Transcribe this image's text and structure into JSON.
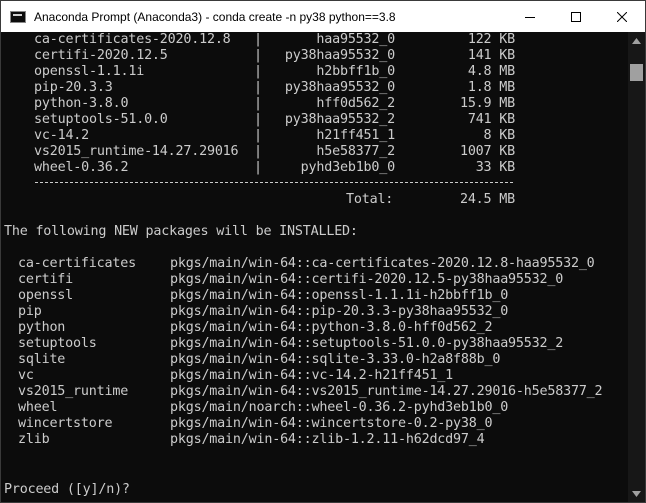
{
  "window": {
    "title": "Anaconda Prompt (Anaconda3) - conda  create -n py38 python==3.8",
    "controls": {
      "minimize": "minimize-icon",
      "maximize": "maximize-icon",
      "close": "close-icon"
    }
  },
  "download_table": [
    {
      "name": "ca-certificates-2020.12.8",
      "build": "haa95532_0",
      "size": "122 KB"
    },
    {
      "name": "certifi-2020.12.5",
      "build": "py38haa95532_0",
      "size": "141 KB"
    },
    {
      "name": "openssl-1.1.1i",
      "build": "h2bbff1b_0",
      "size": "4.8 MB"
    },
    {
      "name": "pip-20.3.3",
      "build": "py38haa95532_0",
      "size": "1.8 MB"
    },
    {
      "name": "python-3.8.0",
      "build": "hff0d562_2",
      "size": "15.9 MB"
    },
    {
      "name": "setuptools-51.0.0",
      "build": "py38haa95532_2",
      "size": "741 KB"
    },
    {
      "name": "vc-14.2",
      "build": "h21ff451_1",
      "size": "8 KB"
    },
    {
      "name": "vs2015_runtime-14.27.29016",
      "build": "h5e58377_2",
      "size": "1007 KB"
    },
    {
      "name": "wheel-0.36.2",
      "build": "pyhd3eb1b0_0",
      "size": "33 KB"
    }
  ],
  "total": {
    "label": "Total:",
    "size": "24.5 MB"
  },
  "install_header": "The following NEW packages will be INSTALLED:",
  "install_list": [
    {
      "pkg": "ca-certificates",
      "spec": "pkgs/main/win-64::ca-certificates-2020.12.8-haa95532_0"
    },
    {
      "pkg": "certifi",
      "spec": "pkgs/main/win-64::certifi-2020.12.5-py38haa95532_0"
    },
    {
      "pkg": "openssl",
      "spec": "pkgs/main/win-64::openssl-1.1.1i-h2bbff1b_0"
    },
    {
      "pkg": "pip",
      "spec": "pkgs/main/win-64::pip-20.3.3-py38haa95532_0"
    },
    {
      "pkg": "python",
      "spec": "pkgs/main/win-64::python-3.8.0-hff0d562_2"
    },
    {
      "pkg": "setuptools",
      "spec": "pkgs/main/win-64::setuptools-51.0.0-py38haa95532_2"
    },
    {
      "pkg": "sqlite",
      "spec": "pkgs/main/win-64::sqlite-3.33.0-h2a8f88b_0"
    },
    {
      "pkg": "vc",
      "spec": "pkgs/main/win-64::vc-14.2-h21ff451_1"
    },
    {
      "pkg": "vs2015_runtime",
      "spec": "pkgs/main/win-64::vs2015_runtime-14.27.29016-h5e58377_2"
    },
    {
      "pkg": "wheel",
      "spec": "pkgs/main/noarch::wheel-0.36.2-pyhd3eb1b0_0"
    },
    {
      "pkg": "wincertstore",
      "spec": "pkgs/main/win-64::wincertstore-0.2-py38_0"
    },
    {
      "pkg": "zlib",
      "spec": "pkgs/main/win-64::zlib-1.2.11-h62dcd97_4"
    }
  ],
  "prompt": "Proceed ([y]/n)?",
  "colors": {
    "background": "#0c0c0c",
    "text": "#cccccc",
    "titlebar": "#ffffff"
  }
}
